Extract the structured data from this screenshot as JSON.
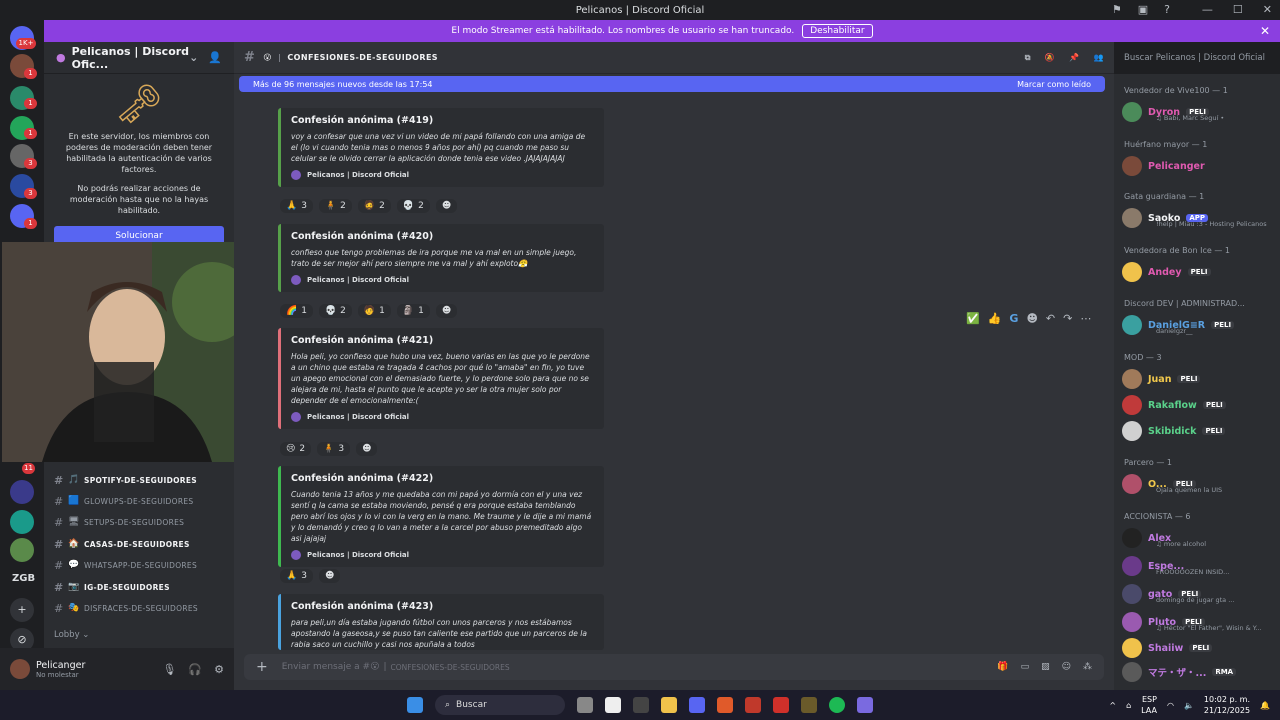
{
  "window": {
    "title": "Pelicanos | Discord Oficial"
  },
  "streamer": {
    "message": "El modo Streamer está habilitado. Los nombres de usuario se han truncado.",
    "button": "Deshabilitar",
    "close": "✕"
  },
  "guilds": {
    "badge_top": "1K+",
    "badges": [
      "1",
      "1",
      "1",
      "3",
      "3",
      "1",
      "11"
    ],
    "zgb": "ZGB"
  },
  "sidebar": {
    "server_name": "Pelicanos | Discord Ofic...",
    "mod_text_1": "En este servidor, los miembros con poderes de moderación deben tener habilitada la autenticación de varios factores.",
    "mod_text_2": "No podrás realizar acciones de moderación hasta que no la hayas habilitado.",
    "fix_button": "Solucionar",
    "channels": [
      {
        "emoji": "🎵",
        "name": "spotify-de-seguidores",
        "unread": true
      },
      {
        "emoji": "🟦",
        "name": "glowups-de-seguidores",
        "unread": false
      },
      {
        "emoji": "🖥",
        "name": "setups-de-seguidores",
        "unread": false
      },
      {
        "emoji": "🏠",
        "name": "casas-de-seguidores",
        "unread": true
      },
      {
        "emoji": "💬",
        "name": "whatsapp-de-seguidores",
        "unread": false
      },
      {
        "emoji": "📷",
        "name": "ig-de-seguidores",
        "unread": true
      },
      {
        "emoji": "🎭",
        "name": "disfraces-de-seguidores",
        "unread": false
      }
    ],
    "lobby": "Lobby"
  },
  "user": {
    "name": "Pelicanger",
    "status": "No molestar"
  },
  "channel": {
    "emoji": "😮",
    "name": "confesiones-de-seguidores"
  },
  "new_messages": {
    "text": "Más de 96 mensajes nuevos desde las 17:54",
    "mark_read": "Marcar como leído"
  },
  "posts": [
    {
      "title": "Confesión anónima (#419)",
      "body": "voy a confesar que una vez vi un video de mi papá follando con una amiga de el (lo vi cuando tenia mas o menos 9 años por ahí) pq cuando me paso su celular se le olvido cerrar la aplicación donde tenia ese video .JAJAJAJAJAJ",
      "footer": "Pelicanos | Discord Oficial",
      "color": "#57a14a",
      "reactions": [
        {
          "e": "🙏",
          "n": "3"
        },
        {
          "e": "🧍",
          "n": "2"
        },
        {
          "e": "🧔",
          "n": "2"
        },
        {
          "e": "💀",
          "n": "2"
        },
        {
          "e": "☻",
          "n": ""
        }
      ]
    },
    {
      "title": "Confesión anónima (#420)",
      "body": "confieso que tengo problemas de ira porque me va mal en un simple juego, trato de ser mejor ahí pero siempre me va mal y ahí exploto😤",
      "footer": "Pelicanos | Discord Oficial",
      "color": "#57a14a",
      "reactions": [
        {
          "e": "🌈",
          "n": "1"
        },
        {
          "e": "💀",
          "n": "2"
        },
        {
          "e": "🧑",
          "n": "1"
        },
        {
          "e": "🗿",
          "n": "1"
        },
        {
          "e": "☻",
          "n": ""
        }
      ]
    },
    {
      "title": "Confesión anónima (#421)",
      "body": "Hola peli, yo confieso que hubo una vez, bueno varias en las que yo le perdone a un chino que estaba re tragada 4 cachos por qué lo \"amaba\" en fin, yo tuve un apego emocional con el demasiado fuerte, y lo perdone solo para que no se alejara de mi, hasta el punto que le acepte yo ser la otra mujer solo por depender de el emocionalmente:(",
      "footer": "Pelicanos | Discord Oficial",
      "color": "#e0707a",
      "reactions": [
        {
          "e": "😢",
          "n": "2"
        },
        {
          "e": "🧍",
          "n": "3"
        },
        {
          "e": "☻",
          "n": ""
        }
      ]
    },
    {
      "title": "Confesión anónima (#422)",
      "body": "Cuando tenia 13 años y me quedaba con mi papá yo dormía con el y una vez sentí q la cama se estaba moviendo, pensé q era porque estaba temblando pero abrí los ojos y lo vi con la verg en la mano. Me traume y le dije a mi mamá y lo demandó y creo q lo van a meter a la carcel por abuso premeditado algo asi jajajaj",
      "footer": "Pelicanos | Discord Oficial",
      "color": "#3fb950",
      "reactions": [
        {
          "e": "🙏",
          "n": "3"
        },
        {
          "e": "☻",
          "n": ""
        }
      ]
    },
    {
      "title": "Confesión anónima (#423)",
      "body": "para peli,un día estaba jugando fútbol con unos parceros y nos estábamos apostando la gaseosa,y se puso tan caliente ese partido que un parceros de la rabia saco un cuchillo y casi nos apuñala a todos",
      "footer": "",
      "color": "#4aa3df",
      "reactions": []
    }
  ],
  "hover_actions": [
    "✅",
    "👍",
    "G",
    "☻",
    "↶",
    "↷",
    "⋯"
  ],
  "input": {
    "placeholder_prefix": "Enviar mensaje a #",
    "emoji": "😮",
    "channel": "confesiones-de-seguidores"
  },
  "members": {
    "search_placeholder": "Buscar Pelicanos | Discord Oficial",
    "groups": [
      {
        "role": "Vendedor de Vive100 — 1",
        "members": [
          {
            "name": "Dyron",
            "tag": "PELI",
            "sub": "♫ Babi, Marc Seguí •",
            "color": "#e05ab0",
            "av": "#4b8b5a"
          }
        ]
      },
      {
        "role": "Huérfano mayor — 1",
        "members": [
          {
            "name": "Pelicanger",
            "tag": "",
            "sub": "",
            "color": "#e05ab0",
            "av": "#7a4a3a"
          }
        ]
      },
      {
        "role": "Gata guardiana — 1",
        "members": [
          {
            "name": "Saoko",
            "tag": "APP",
            "sub": "!help | Miau :3 - Hosting Pelicanos",
            "color": "#f2f3f5",
            "av": "#8a7a6a"
          }
        ]
      },
      {
        "role": "Vendedora de Bon Ice — 1",
        "members": [
          {
            "name": "Andey",
            "tag": "PELI",
            "sub": "",
            "color": "#e05ab0",
            "av": "#f0c24b"
          }
        ]
      },
      {
        "role": "Discord DEV | ADMINISTRAD...",
        "members": [
          {
            "name": "DanielG≡R",
            "tag": "PELI",
            "sub": "danielgzr__",
            "color": "#5aa0e0",
            "av": "#3aa0a0"
          }
        ]
      },
      {
        "role": "MOD — 3",
        "members": [
          {
            "name": "Juan",
            "tag": "PELI",
            "sub": "",
            "color": "#f2c94c",
            "av": "#a07a5a"
          },
          {
            "name": "Rakaflow",
            "tag": "PELI",
            "sub": "",
            "color": "#5ad18a",
            "av": "#c03a3a"
          },
          {
            "name": "Skibidick",
            "tag": "PELI",
            "sub": "",
            "color": "#5ad18a",
            "av": "#d0d0d0"
          }
        ]
      },
      {
        "role": "Parcero — 1",
        "members": [
          {
            "name": "O...",
            "tag": "PELI",
            "sub": "Ojala quemen la UIS",
            "color": "#f2c94c",
            "av": "#b0506a"
          }
        ]
      },
      {
        "role": "ACCIONISTA — 6",
        "members": [
          {
            "name": "Alex",
            "tag": "",
            "sub": "♫ more alcohol",
            "color": "#c07ae0",
            "av": "#222"
          },
          {
            "name": "Espe...",
            "tag": "",
            "sub": "FROOOOOZEN INSID...",
            "color": "#c07ae0",
            "av": "#6a3a8a"
          },
          {
            "name": "gato",
            "tag": "PELI",
            "sub": "domingo de jugar gta ...",
            "color": "#c07ae0",
            "av": "#4a4a6a"
          },
          {
            "name": "Pluto",
            "tag": "PELI",
            "sub": "♫ Héctor \"El Father\", Wisin & Y...",
            "color": "#c07ae0",
            "av": "#9a5ab0"
          },
          {
            "name": "Shaiiw",
            "tag": "PELI",
            "sub": "",
            "color": "#c07ae0",
            "av": "#f0c24b"
          },
          {
            "name": "マテ・ザ・...",
            "tag": "RMA",
            "sub": "",
            "color": "#c07ae0",
            "av": "#5a5a5a"
          }
        ]
      }
    ]
  },
  "taskbar": {
    "search": "Buscar",
    "lang": "ESP",
    "layout": "LAA",
    "time": "10:02 p. m.",
    "date": "21/12/2025"
  }
}
